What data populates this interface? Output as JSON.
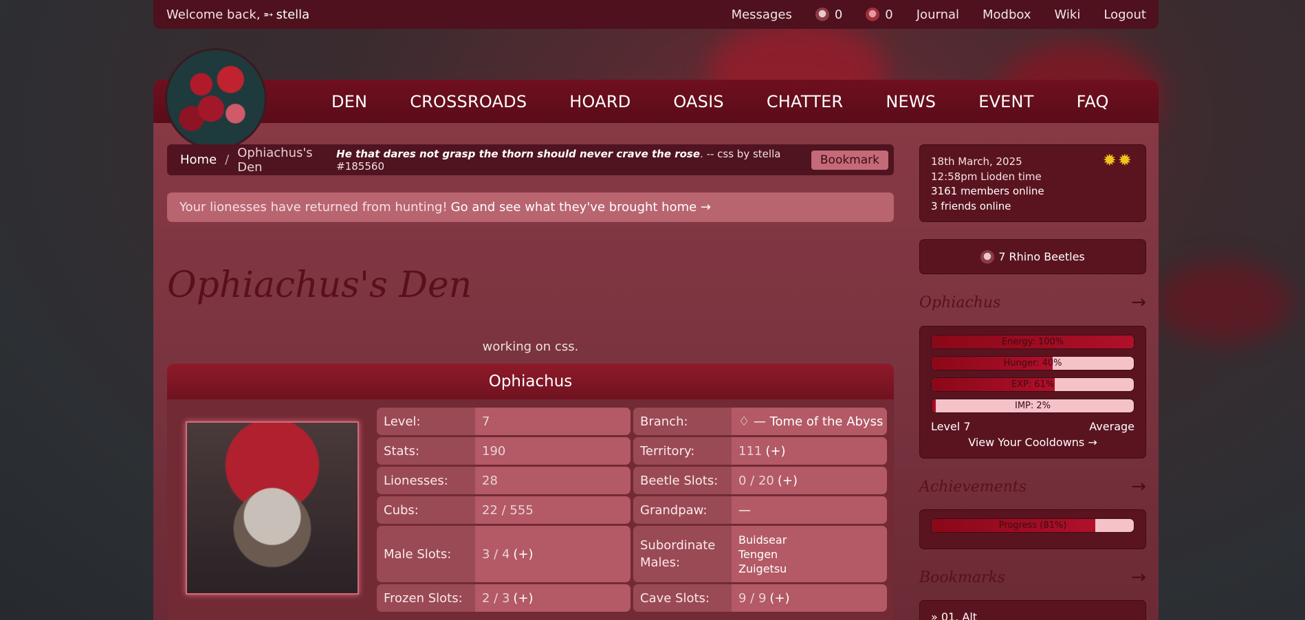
{
  "topbar": {
    "welcome_prefix": "Welcome back,",
    "user_arrow": "➵",
    "username": "stella",
    "messages": "Messages",
    "beetle_count_1": "0",
    "beetle_count_2": "0",
    "journal": "Journal",
    "modbox": "Modbox",
    "wiki": "Wiki",
    "logout": "Logout"
  },
  "nav": {
    "items": [
      "DEN",
      "CROSSROADS",
      "HOARD",
      "OASIS",
      "CHATTER",
      "NEWS",
      "EVENT",
      "FAQ"
    ]
  },
  "breadcrumb": {
    "home": "Home",
    "separator": "/",
    "current": "Ophiachus's Den",
    "quote": "He that dares not grasp the thorn should never crave the rose",
    "credit": ". -- css by stella #185560",
    "bookmark": "Bookmark"
  },
  "alert": {
    "text": "Your lionesses have returned from hunting!",
    "link": "Go and see what they've brought home →"
  },
  "den": {
    "title": "Ophiachus's Den",
    "status": "working on css.",
    "lion_name": "Ophiachus"
  },
  "stats_left": [
    {
      "label": "Level:",
      "value": "7",
      "plus": ""
    },
    {
      "label": "Stats:",
      "value": "190",
      "plus": ""
    },
    {
      "label": "Lionesses:",
      "value": "28",
      "plus": ""
    },
    {
      "label": "Cubs:",
      "value": "22 / 555",
      "plus": ""
    },
    {
      "label": "Male Slots:",
      "value": "3 / 4",
      "plus": "(+)"
    },
    {
      "label": "Frozen Slots:",
      "value": "2 / 3",
      "plus": "(+)"
    }
  ],
  "stats_right": [
    {
      "label": "Branch:",
      "value": "♢ — Tome of the Abyss",
      "plus": ""
    },
    {
      "label": "Territory:",
      "value": "111",
      "plus": "(+)"
    },
    {
      "label": "Beetle Slots:",
      "value": "0 / 20",
      "plus": "(+)"
    },
    {
      "label": "Grandpaw:",
      "value": "—",
      "plus": ""
    },
    {
      "label": "Subordinate Males:",
      "value": "",
      "plus": ""
    },
    {
      "label": "Cave Slots:",
      "value": "9 / 9",
      "plus": "(+)"
    }
  ],
  "subordinate_males": [
    "Buidsear",
    "Tengen",
    "Zuigetsu"
  ],
  "sidebar": {
    "date": "18th March, 2025",
    "time": "12:58pm Lioden time",
    "members_online": "3161 members online",
    "friends_online": "3 friends online",
    "suns": "✹✹",
    "rhino_beetles": "7 Rhino Beetles",
    "lion_heading": "Ophiachus",
    "arrow": "→",
    "bars": [
      {
        "label": "Energy: 100%",
        "fraction": 1.0
      },
      {
        "label": "Hunger: 40%",
        "fraction": 0.6
      },
      {
        "label": "EXP: 61%",
        "fraction": 0.61
      },
      {
        "label": "IMP: 2%",
        "fraction": 0.02
      }
    ],
    "level": "Level 7",
    "average": "Average",
    "cooldowns": "View Your Cooldowns →",
    "achievements_heading": "Achievements",
    "achievement_bar": {
      "label": "Progress (81%)",
      "fraction": 0.81
    },
    "bookmarks_heading": "Bookmarks",
    "bookmark_item": "» 01. Alt"
  }
}
